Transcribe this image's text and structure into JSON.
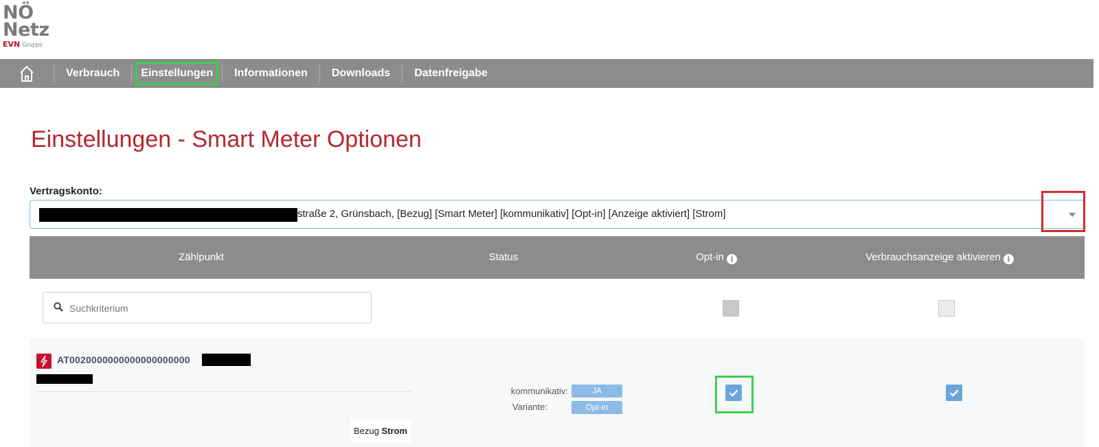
{
  "logo": {
    "line1": "NÖ",
    "line2": "Netz",
    "brand": "EVN",
    "group": "Gruppe"
  },
  "nav": {
    "home_icon": "home-icon",
    "items": [
      "Verbrauch",
      "Einstellungen",
      "Informationen",
      "Downloads",
      "Datenfreigabe"
    ],
    "active": "Einstellungen"
  },
  "page": {
    "title": "Einstellungen - Smart Meter Optionen"
  },
  "contract": {
    "label": "Vertragskonto:",
    "selected_value": "straße 2, Grünsbach, [Bezug] [Smart Meter] [kommunikativ] [Opt-in] [Anzeige aktiviert] [Strom]"
  },
  "table": {
    "headers": {
      "zaehlpunkt": "Zählpunkt",
      "status": "Status",
      "optin": "Opt-in",
      "verbrauch": "Verbrauchsanzeige aktivieren"
    },
    "search_placeholder": "Suchkriterium",
    "rows": [
      {
        "meter_id": "AT0020000000000000000000",
        "kommunikativ_label": "kommunikativ:",
        "kommunikativ_value": "JA",
        "variante_label": "Variante:",
        "variante_value": "Opt-in",
        "optin_checked": true,
        "verbrauch_checked": true,
        "bezug_prefix": "Bezug",
        "bezug_type": "Strom"
      }
    ]
  },
  "colors": {
    "accent_red": "#b3282d",
    "nav_grey": "#8c8c8c",
    "checkbox_blue": "#6aa6da",
    "highlight_green": "#39d04d",
    "highlight_red": "#d52b2b"
  }
}
